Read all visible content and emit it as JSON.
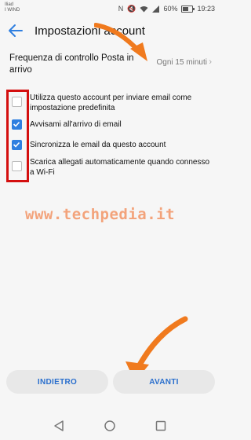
{
  "status_bar": {
    "carrier_line1": "Iliad",
    "carrier_line2": "I WIND",
    "battery_text": "60%",
    "battery_level": 0.6,
    "time": "19:23",
    "icons": [
      "nfc-icon",
      "mute-icon",
      "wifi-icon",
      "signal-icon",
      "battery-icon"
    ]
  },
  "app_bar": {
    "back_icon": "back-arrow-icon",
    "title": "Impostazioni account"
  },
  "frequency": {
    "label": "Frequenza di controllo Posta in arrivo",
    "value": "Ogni 15 minuti"
  },
  "options": [
    {
      "label": "Utilizza questo account per inviare email come impostazione predefinita",
      "checked": false
    },
    {
      "label": "Avvisami all'arrivo di email",
      "checked": true
    },
    {
      "label": "Sincronizza le email da questo account",
      "checked": true
    },
    {
      "label": "Scarica allegati automaticamente quando connesso a Wi-Fi",
      "checked": false
    }
  ],
  "watermark": "www.techpedia.it",
  "buttons": {
    "back_label": "INDIETRO",
    "next_label": "AVANTI"
  },
  "colors": {
    "accent": "#2f7fe0",
    "highlight_box": "#d40f0f",
    "annotation_arrow": "#f07a1e"
  }
}
